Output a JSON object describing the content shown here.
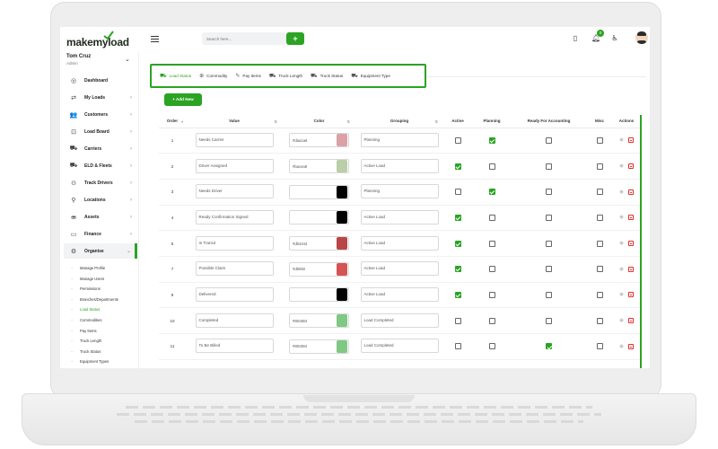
{
  "app": {
    "logo_text_prefix": "make",
    "logo_text_my": "my",
    "logo_text_suffix": "load",
    "search_placeholder": "Search here...",
    "add_label": "+",
    "notification_count": "0",
    "accent_color": "#2ba323"
  },
  "user": {
    "name": "Tom Cruz",
    "role": "Admin"
  },
  "sidebar": {
    "items": [
      {
        "label": "Dashboard",
        "icon": "dashboard-icon",
        "glyph": "◎",
        "chevron": ""
      },
      {
        "label": "My Loads",
        "icon": "truck-icon",
        "glyph": "⇄",
        "chevron": "›"
      },
      {
        "label": "Customers",
        "icon": "customers-icon",
        "glyph": "👥",
        "chevron": "›"
      },
      {
        "label": "Load Board",
        "icon": "chart-icon",
        "glyph": "⊡",
        "chevron": "›"
      },
      {
        "label": "Carriers",
        "icon": "carrier-icon",
        "glyph": "⛟",
        "chevron": "›"
      },
      {
        "label": "ELD & Fleets",
        "icon": "fleet-icon",
        "glyph": "⛟",
        "chevron": "›"
      },
      {
        "label": "Track Drivers",
        "icon": "location-pin-icon",
        "glyph": "⊙",
        "chevron": "›"
      },
      {
        "label": "Locations",
        "icon": "pin-icon",
        "glyph": "⚲",
        "chevron": "›"
      },
      {
        "label": "Assets",
        "icon": "assets-icon",
        "glyph": "⛂",
        "chevron": "›"
      },
      {
        "label": "Finance",
        "icon": "finance-icon",
        "glyph": "▭",
        "chevron": "›"
      },
      {
        "label": "Organise",
        "icon": "gear-icon",
        "glyph": "⚙",
        "chevron": "⌄"
      }
    ],
    "sub_items": [
      "Manage Profile",
      "Manage Users",
      "Permissions",
      "Branches/Departments",
      "Load Status",
      "Commodities",
      "Pay Items",
      "Truck Length",
      "Truck Status",
      "Equipment Types"
    ]
  },
  "tabs": [
    {
      "label": "Load Status",
      "icon": "load-status-icon",
      "glyph": "⛟"
    },
    {
      "label": "Commodity",
      "icon": "commodity-icon",
      "glyph": "⊕"
    },
    {
      "label": "Pay Items",
      "icon": "pay-items-icon",
      "glyph": "✎"
    },
    {
      "label": "Truck Length",
      "icon": "truck-length-icon",
      "glyph": "⛟"
    },
    {
      "label": "Truck Status",
      "icon": "truck-status-icon",
      "glyph": "⛟"
    },
    {
      "label": "Equipment Type",
      "icon": "equipment-icon",
      "glyph": "⛟"
    }
  ],
  "add_new_label": "+ Add New",
  "table": {
    "headers": [
      "Order",
      "Value",
      "Color",
      "Grouping",
      "Active",
      "Planning",
      "Ready For Accounting",
      "Misc",
      "Actions"
    ],
    "rows": [
      {
        "order": "1",
        "value": "Needs Carrier",
        "hex": "#daa1a6",
        "swatch": "#daa1a6",
        "grouping": "Planning",
        "active": false,
        "planning": true,
        "ready": false,
        "misc": false
      },
      {
        "order": "2",
        "value": "Driver Assigned",
        "hex": "#bacea8",
        "swatch": "#bacea8",
        "grouping": "Active Load",
        "active": true,
        "planning": false,
        "ready": false,
        "misc": false
      },
      {
        "order": "3",
        "value": "Needs Driver",
        "hex": "",
        "swatch": "#000000",
        "grouping": "Planning",
        "active": false,
        "planning": true,
        "ready": false,
        "misc": false
      },
      {
        "order": "4",
        "value": "Ready Confirmation Signed",
        "hex": "",
        "swatch": "#000000",
        "grouping": "Active Load",
        "active": true,
        "planning": false,
        "ready": false,
        "misc": false
      },
      {
        "order": "5",
        "value": "In Transit",
        "hex": "#db4444",
        "swatch": "#b94646",
        "grouping": "Active Load",
        "active": true,
        "planning": false,
        "ready": false,
        "misc": false
      },
      {
        "order": "7",
        "value": "Possible Claim",
        "hex": "#d5050",
        "swatch": "#d45454",
        "grouping": "Active Load",
        "active": true,
        "planning": false,
        "ready": false,
        "misc": false
      },
      {
        "order": "9",
        "value": "Delivered",
        "hex": "",
        "swatch": "#000000",
        "grouping": "Active Load",
        "active": true,
        "planning": false,
        "ready": false,
        "misc": false
      },
      {
        "order": "10",
        "value": "Completed",
        "hex": "#80c884",
        "swatch": "#80c884",
        "grouping": "Load Completed",
        "active": false,
        "planning": false,
        "ready": false,
        "misc": false
      },
      {
        "order": "11",
        "value": "To Be Billed",
        "hex": "#80c884",
        "swatch": "#80c884",
        "grouping": "Load Completed",
        "active": false,
        "planning": false,
        "ready": true,
        "misc": false
      }
    ]
  }
}
